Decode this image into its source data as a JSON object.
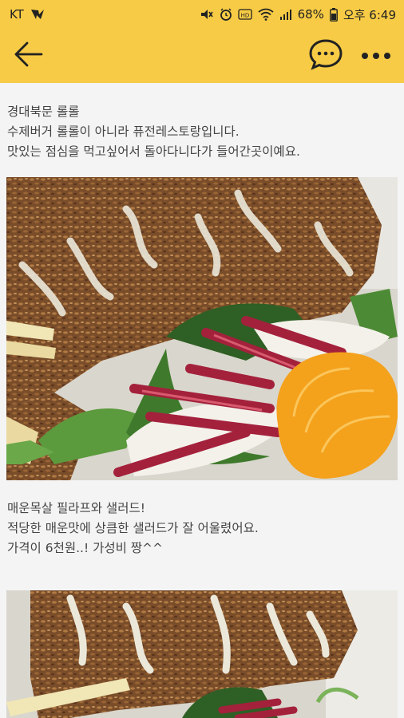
{
  "status_bar": {
    "carrier": "KT",
    "battery": "68%",
    "time": "오후 6:49",
    "icons": [
      "carrier-signal-icon",
      "mute-icon",
      "alarm-icon",
      "hd-voice-icon",
      "wifi-icon",
      "cell-signal-icon",
      "battery-icon"
    ]
  },
  "app_bar": {
    "icons": [
      "back-arrow-icon",
      "chat-bubble-icon",
      "more-options-icon"
    ],
    "accent_color": "#f7cb45"
  },
  "post": {
    "paragraph1": [
      "경대북문 롤롤",
      "수제버거 롤롤이 아니라 퓨전레스토랑입니다.",
      "맛있는 점심을 먹고싶어서 돌아다니다가 들어간곳이예요."
    ],
    "paragraph2": [
      "매운목살 필라프와 샐러드!",
      "적당한 매운맛에 상큼한 샐러드가 잘 어울렸어요.",
      "가격이 6천원..! 가성비 짱^^"
    ]
  }
}
